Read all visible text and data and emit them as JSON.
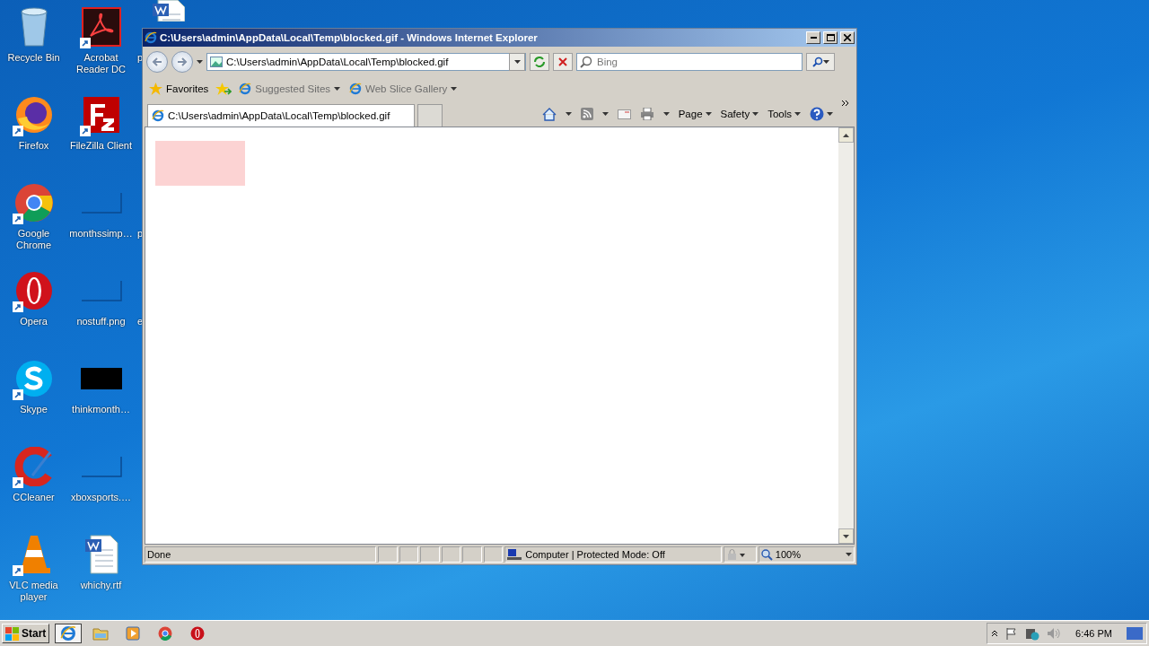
{
  "desktop": {
    "columns": [
      [
        {
          "label": "Recycle Bin",
          "kind": "recycle"
        },
        {
          "label": "Firefox",
          "kind": "firefox",
          "shortcut": true
        },
        {
          "label": "Google Chrome",
          "kind": "chrome",
          "shortcut": true
        },
        {
          "label": "Opera",
          "kind": "opera",
          "shortcut": true
        },
        {
          "label": "Skype",
          "kind": "skype",
          "shortcut": true
        },
        {
          "label": "CCleaner",
          "kind": "ccleaner",
          "shortcut": true
        },
        {
          "label": "VLC media player",
          "kind": "vlc",
          "shortcut": true
        }
      ],
      [
        {
          "label": "Acrobat Reader DC",
          "kind": "acrobat",
          "shortcut": true
        },
        {
          "label": "FileZilla Client",
          "kind": "filezilla",
          "shortcut": true
        },
        {
          "label": "monthssimp…",
          "kind": "blank"
        },
        {
          "label": "nostuff.png",
          "kind": "blank"
        },
        {
          "label": "thinkmonth…",
          "kind": "black"
        },
        {
          "label": "xboxsports.…",
          "kind": "blank"
        },
        {
          "label": "whichy.rtf",
          "kind": "word"
        }
      ],
      [
        {
          "label": "p",
          "kind": "wordtop"
        },
        {
          "kind": "hidden"
        },
        {
          "label": "p",
          "kind": "hidden"
        },
        {
          "label": "e",
          "kind": "hidden"
        }
      ]
    ]
  },
  "window": {
    "title": "C:\\Users\\admin\\AppData\\Local\\Temp\\blocked.gif - Windows Internet Explorer",
    "address": "C:\\Users\\admin\\AppData\\Local\\Temp\\blocked.gif",
    "search": {
      "placeholder": "Bing"
    },
    "favorites": {
      "label": "Favorites",
      "links": [
        "Suggested Sites",
        "Web Slice Gallery"
      ]
    },
    "tabs": [
      {
        "label": "C:\\Users\\admin\\AppData\\Local\\Temp\\blocked.gif",
        "selected": true
      }
    ],
    "commands": [
      "Page",
      "Safety",
      "Tools"
    ],
    "status": {
      "text": "Done",
      "zone": "Computer | Protected Mode: Off",
      "zoom": "100%"
    }
  },
  "taskbar": {
    "start": "Start",
    "apps": [
      {
        "kind": "ie",
        "selected": true
      },
      {
        "kind": "explorer",
        "selected": false
      },
      {
        "kind": "media",
        "selected": false
      },
      {
        "kind": "chrome",
        "selected": false
      },
      {
        "kind": "opera",
        "selected": false
      }
    ],
    "clock": "6:46 PM"
  }
}
